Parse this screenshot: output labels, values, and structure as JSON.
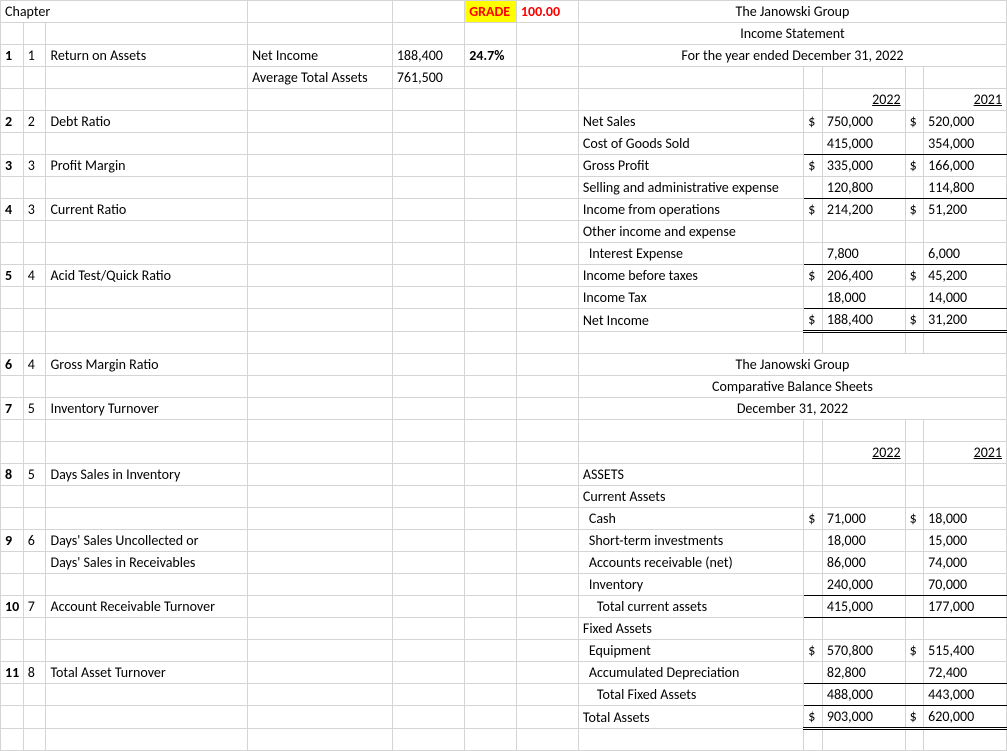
{
  "topLeft": "Chapter",
  "grade": {
    "label": "GRADE",
    "value": "100.00"
  },
  "ratios": {
    "r1": {
      "n": "1",
      "c": "1",
      "name": "Return on Assets",
      "calc1": "Net Income",
      "val1": "188,400",
      "pct": "24.7%",
      "calc2": "Average Total Assets",
      "val2": "761,500"
    },
    "r2": {
      "n": "2",
      "c": "2",
      "name": "Debt Ratio"
    },
    "r3": {
      "n": "3",
      "c": "3",
      "name": "Profit Margin"
    },
    "r4": {
      "n": "4",
      "c": "3",
      "name": "Current Ratio"
    },
    "r5": {
      "n": "5",
      "c": "4",
      "name": "Acid Test/Quick Ratio"
    },
    "r6": {
      "n": "6",
      "c": "4",
      "name": "Gross Margin Ratio"
    },
    "r7": {
      "n": "7",
      "c": "5",
      "name": "Inventory Turnover"
    },
    "r8": {
      "n": "8",
      "c": "5",
      "name": "Days Sales in Inventory"
    },
    "r9": {
      "n": "9",
      "c": "6",
      "name": "Days' Sales Uncollected or",
      "name2": "Days' Sales in Receivables"
    },
    "r10": {
      "n": "10",
      "c": "7",
      "name": "Account Receivable Turnover"
    },
    "r11": {
      "n": "11",
      "c": "8",
      "name": "Total Asset Turnover"
    }
  },
  "is": {
    "company": "The Janowski Group",
    "title": "Income Statement",
    "period": "For the year ended December 31, 2022",
    "colA": "2022",
    "colB": "2021",
    "rows": {
      "netSales": {
        "label": "Net Sales",
        "curA": "$",
        "a": "750,000",
        "curB": "$",
        "b": "520,000"
      },
      "cogs": {
        "label": "Cost of Goods Sold",
        "a": "415,000",
        "b": "354,000"
      },
      "gp": {
        "label": "Gross Profit",
        "curA": "$",
        "a": "335,000",
        "curB": "$",
        "b": "166,000"
      },
      "sga": {
        "label": "Selling and administrative expense",
        "a": "120,800",
        "b": "114,800"
      },
      "opinc": {
        "label": "Income from operations",
        "curA": "$",
        "a": "214,200",
        "curB": "$",
        "b": "51,200"
      },
      "other": {
        "label": "Other income and expense"
      },
      "intexp": {
        "label": "Interest Expense",
        "a": "7,800",
        "b": "6,000"
      },
      "pretax": {
        "label": "Income before taxes",
        "curA": "$",
        "a": "206,400",
        "curB": "$",
        "b": "45,200"
      },
      "tax": {
        "label": "Income Tax",
        "a": "18,000",
        "b": "14,000"
      },
      "ni": {
        "label": "Net Income",
        "curA": "$",
        "a": "188,400",
        "curB": "$",
        "b": "31,200"
      }
    }
  },
  "bs": {
    "company": "The Janowski Group",
    "title": "Comparative Balance Sheets",
    "period": "December 31, 2022",
    "colA": "2022",
    "colB": "2021",
    "sections": {
      "assets": "ASSETS",
      "ca": "Current Assets",
      "cash": {
        "label": "Cash",
        "curA": "$",
        "a": "71,000",
        "curB": "$",
        "b": "18,000"
      },
      "sti": {
        "label": "Short-term investments",
        "a": "18,000",
        "b": "15,000"
      },
      "ar": {
        "label": "Accounts receivable (net)",
        "a": "86,000",
        "b": "74,000"
      },
      "inv": {
        "label": "Inventory",
        "a": "240,000",
        "b": "70,000"
      },
      "tca": {
        "label": "Total current assets",
        "a": "415,000",
        "b": "177,000"
      },
      "fa": "Fixed Assets",
      "equip": {
        "label": "Equipment",
        "curA": "$",
        "a": "570,800",
        "curB": "$",
        "b": "515,400"
      },
      "accdep": {
        "label": "Accumulated Depreciation",
        "a": "82,800",
        "b": "72,400"
      },
      "tfa": {
        "label": "Total Fixed Assets",
        "a": "488,000",
        "b": "443,000"
      },
      "ta": {
        "label": "Total Assets",
        "curA": "$",
        "a": "903,000",
        "curB": "$",
        "b": "620,000"
      }
    }
  }
}
